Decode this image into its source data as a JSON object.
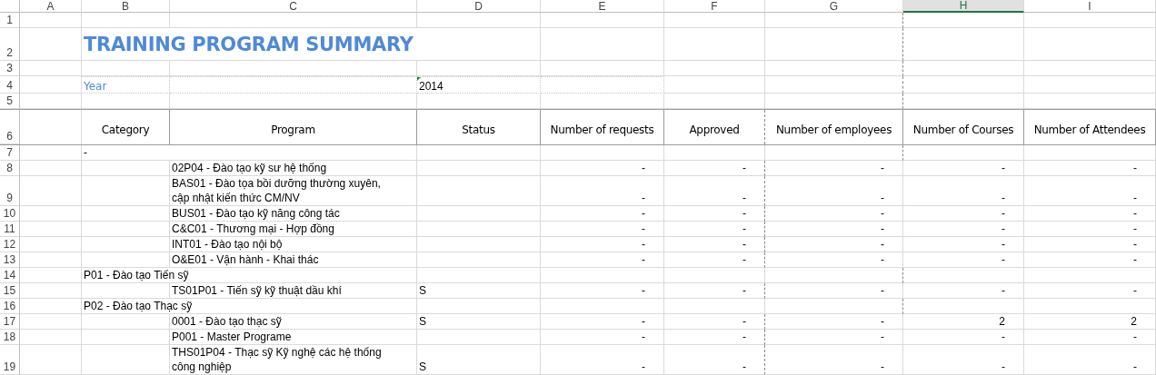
{
  "column_headers": [
    {
      "label": "A",
      "selected": false
    },
    {
      "label": "B",
      "selected": false
    },
    {
      "label": "C",
      "selected": false
    },
    {
      "label": "D",
      "selected": false
    },
    {
      "label": "E",
      "selected": false
    },
    {
      "label": "F",
      "selected": false
    },
    {
      "label": "G",
      "selected": false
    },
    {
      "label": "H",
      "selected": true
    },
    {
      "label": "I",
      "selected": false
    }
  ],
  "row_headers": [
    "1",
    "2",
    "3",
    "4",
    "5",
    "6",
    "7",
    "8",
    "9",
    "10",
    "11",
    "12",
    "13",
    "14",
    "15",
    "16",
    "17",
    "18",
    "19"
  ],
  "title": "TRAINING PROGRAM SUMMARY",
  "year": {
    "label": "Year",
    "value": "2014"
  },
  "table": {
    "columns": [
      "Category",
      "Program",
      "Status",
      "Number of requests",
      "Approved",
      "Number of employees",
      "Number of Courses",
      "Number of Attendees"
    ],
    "rows": [
      {
        "kind": "category",
        "category": "-"
      },
      {
        "kind": "program",
        "program": "02P04 - Đào tạo kỹ sư hệ thống",
        "values": [
          "-",
          "-",
          "-",
          "-",
          "-"
        ]
      },
      {
        "kind": "program",
        "program": "BAS01 - Đào tọa bồi dưỡng thường xuyên, cập nhật kiến thức CM/NV",
        "values": [
          "-",
          "-",
          "-",
          "-",
          "-"
        ]
      },
      {
        "kind": "program",
        "program": "BUS01 - Đào tạo kỹ năng công tác",
        "values": [
          "-",
          "-",
          "-",
          "-",
          "-"
        ]
      },
      {
        "kind": "program",
        "program": "C&C01 - Thương mại - Hợp đồng",
        "values": [
          "-",
          "-",
          "-",
          "-",
          "-"
        ]
      },
      {
        "kind": "program",
        "program": "INT01 - Đào tạo nội bộ",
        "values": [
          "-",
          "-",
          "-",
          "-",
          "-"
        ]
      },
      {
        "kind": "program",
        "program": "O&E01 - Vận hành - Khai thác",
        "values": [
          "-",
          "-",
          "-",
          "-",
          "-"
        ]
      },
      {
        "kind": "category",
        "category": "P01 - Đào tạo Tiến sỹ"
      },
      {
        "kind": "program",
        "program": "TS01P01 - Tiến sỹ kỹ thuật dầu khí",
        "status": "S",
        "values": [
          "-",
          "-",
          "-",
          "-",
          "-"
        ]
      },
      {
        "kind": "category",
        "category": "P02 - Đào tạo Thạc sỹ"
      },
      {
        "kind": "program",
        "program": "0001 - Đào tạo thạc sỹ",
        "status": "S",
        "values": [
          "-",
          "-",
          "-",
          "2",
          "2"
        ]
      },
      {
        "kind": "program",
        "program": "P001 - Master Programe",
        "values": [
          "-",
          "-",
          "-",
          "-",
          "-"
        ]
      },
      {
        "kind": "program",
        "program": "THS01P04 - Thạc sỹ Kỹ nghệ các hệ thống công nghiệp",
        "status": "S",
        "values": [
          "-",
          "-",
          "-",
          "-",
          "-"
        ]
      }
    ]
  }
}
